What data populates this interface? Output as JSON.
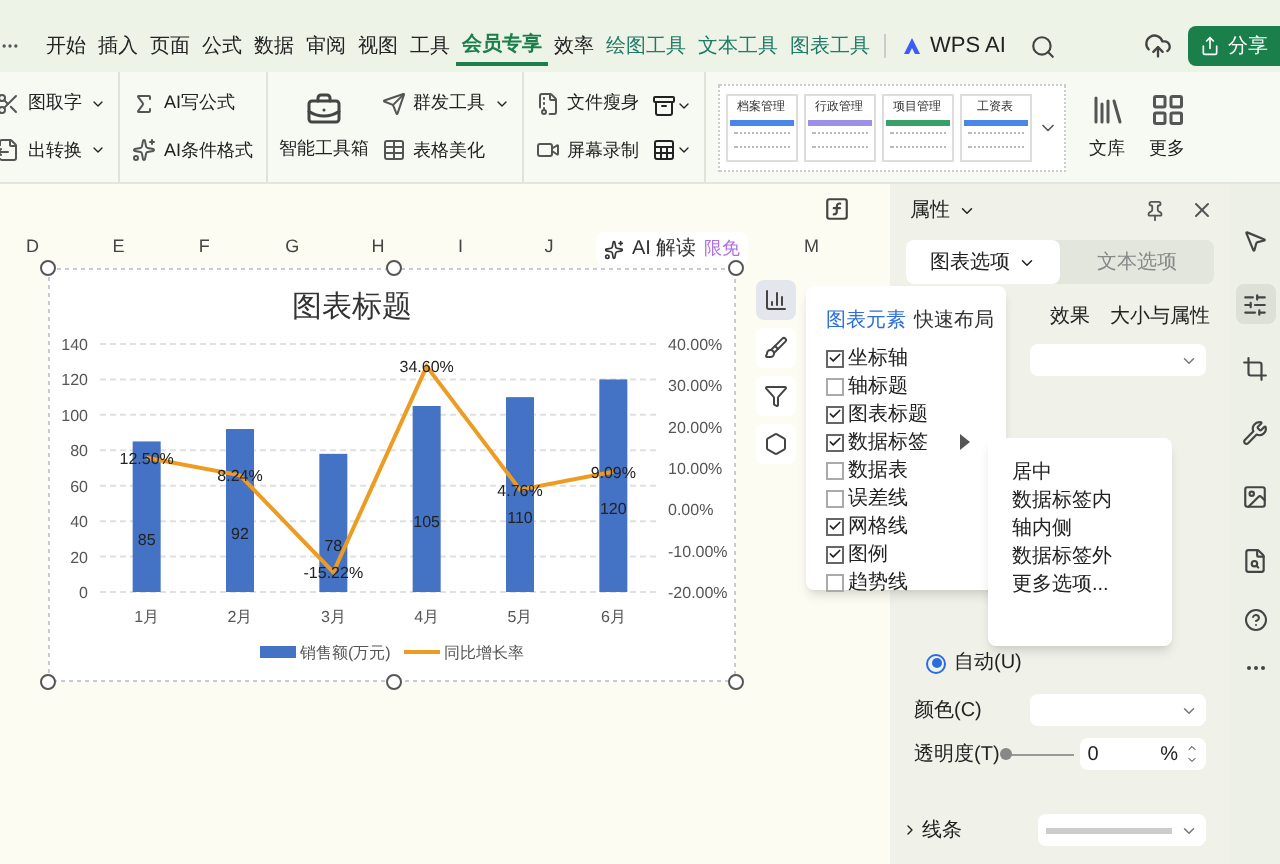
{
  "menu_tabs": [
    {
      "label": "开始",
      "selected": false
    },
    {
      "label": "插入",
      "selected": false
    },
    {
      "label": "页面",
      "selected": false
    },
    {
      "label": "公式",
      "selected": false
    },
    {
      "label": "数据",
      "selected": false
    },
    {
      "label": "审阅",
      "selected": false
    },
    {
      "label": "视图",
      "selected": false
    },
    {
      "label": "工具",
      "selected": false
    },
    {
      "label": "会员专享",
      "selected": true
    },
    {
      "label": "效率",
      "selected": false
    },
    {
      "label": "绘图工具",
      "selected": false,
      "kind": "context"
    },
    {
      "label": "文本工具",
      "selected": false,
      "kind": "context"
    },
    {
      "label": "图表工具",
      "selected": false,
      "kind": "context"
    }
  ],
  "wps_ai": "WPS AI",
  "share_button": "分享",
  "ribbon": {
    "groups": [
      {
        "items": [
          {
            "label": "图取字",
            "kind": "small",
            "dropdown": true
          },
          {
            "label": "出转换",
            "kind": "small",
            "dropdown": true
          }
        ]
      },
      {
        "items": [
          {
            "label": "AI写公式",
            "kind": "small",
            "dropdown": false
          },
          {
            "label": "AI条件格式",
            "kind": "small",
            "dropdown": false
          }
        ]
      },
      {
        "items": [
          {
            "label": "智能工具箱",
            "kind": "big"
          },
          {
            "label": "群发工具",
            "kind": "small",
            "dropdown": true
          },
          {
            "label": "表格美化",
            "kind": "small",
            "dropdown": false
          }
        ]
      },
      {
        "items": [
          {
            "label": "文件瘦身",
            "kind": "small",
            "dropdown": false
          },
          {
            "label": "屏幕录制",
            "kind": "small",
            "dropdown": false
          }
        ]
      }
    ],
    "templates": [
      {
        "label": "档案管理",
        "color": "#4a86e8"
      },
      {
        "label": "行政管理",
        "color": "#9b8fe8"
      },
      {
        "label": "项目管理",
        "color": "#3aa06a"
      },
      {
        "label": "工资表",
        "color": "#4a86e8"
      }
    ],
    "big_buttons": [
      "文库",
      "更多"
    ]
  },
  "columns": [
    "D",
    "E",
    "F",
    "G",
    "H",
    "I",
    "J",
    "M"
  ],
  "ai_button": {
    "label": "AI 解读",
    "badge": "限免"
  },
  "chart": {
    "chart_data": {
      "type": "bar",
      "title": "图表标题",
      "categories": [
        "1月",
        "2月",
        "3月",
        "4月",
        "5月",
        "6月"
      ],
      "series": [
        {
          "name": "销售额(万元)",
          "type": "bar",
          "color": "#4472c4",
          "values": [
            85,
            92,
            78,
            105,
            110,
            120
          ],
          "value_labels": [
            "85",
            "92",
            "78",
            "105",
            "110",
            "120"
          ]
        },
        {
          "name": "同比增长率",
          "type": "line",
          "axis": "y2",
          "color": "#ed9b21",
          "values": [
            12.5,
            8.24,
            -15.22,
            34.6,
            4.76,
            9.09
          ],
          "value_labels": [
            "12.50%",
            "8.24%",
            "-15.22%",
            "34.60%",
            "4.76%",
            "9.09%"
          ]
        }
      ],
      "ylim": [
        0,
        140
      ],
      "yticks": [
        0,
        20,
        40,
        60,
        80,
        100,
        120,
        140
      ],
      "y2lim": [
        -20,
        40
      ],
      "y2ticks": [
        {
          "value": -20,
          "label": "-20.00%"
        },
        {
          "value": -10,
          "label": "-10.00%"
        },
        {
          "value": 0,
          "label": "0.00%"
        },
        {
          "value": 10,
          "label": "10.00%"
        },
        {
          "value": 20,
          "label": "20.00%"
        },
        {
          "value": 30,
          "label": "30.00%"
        },
        {
          "value": 40,
          "label": "40.00%"
        }
      ],
      "grid": true,
      "legend": "bottom",
      "data_labels": true
    },
    "side_buttons": [
      {
        "selected": true
      },
      {
        "selected": false
      },
      {
        "selected": false
      },
      {
        "selected": false
      }
    ]
  },
  "elements_popup": {
    "tabs": [
      {
        "label": "图表元素",
        "selected": true
      },
      {
        "label": "快速布局",
        "selected": false
      }
    ],
    "items": [
      {
        "label": "坐标轴",
        "checked": true,
        "submenu": false
      },
      {
        "label": "轴标题",
        "checked": false,
        "submenu": false
      },
      {
        "label": "图表标题",
        "checked": true,
        "submenu": false
      },
      {
        "label": "数据标签",
        "checked": true,
        "submenu": true
      },
      {
        "label": "数据表",
        "checked": false,
        "submenu": false
      },
      {
        "label": "误差线",
        "checked": false,
        "submenu": false
      },
      {
        "label": "网格线",
        "checked": true,
        "submenu": false
      },
      {
        "label": "图例",
        "checked": true,
        "submenu": false
      },
      {
        "label": "趋势线",
        "checked": false,
        "submenu": false
      }
    ],
    "submenu": [
      "居中",
      "数据标签内",
      "轴内侧",
      "数据标签外",
      "更多选项..."
    ]
  },
  "panel": {
    "title": "属性",
    "tabs": [
      {
        "label": "图表选项",
        "selected": true
      },
      {
        "label": "文本选项",
        "selected": false
      }
    ],
    "subtabs": [
      "效果",
      "大小与属性"
    ],
    "fill_auto": {
      "label": "自动(U)",
      "selected": true
    },
    "color_label": "颜色(C)",
    "transparency": {
      "label": "透明度(T)",
      "level": 0,
      "value": "0",
      "unit": "%"
    },
    "line_section": {
      "label": "线条",
      "expanded": false
    }
  },
  "right_strip": [
    {
      "selected": false
    },
    {
      "selected": true
    },
    {
      "selected": false
    },
    {
      "selected": false
    },
    {
      "selected": false
    },
    {
      "selected": false
    }
  ]
}
